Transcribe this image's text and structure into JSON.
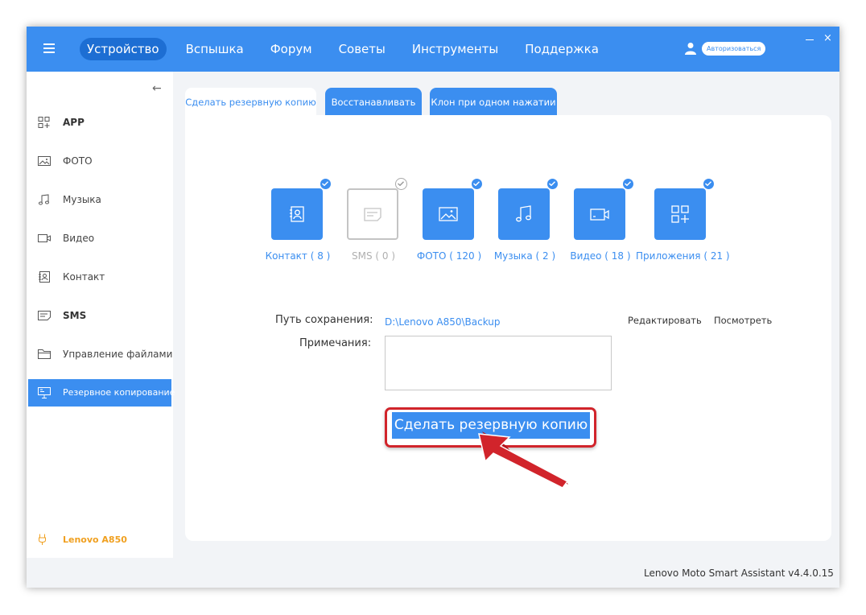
{
  "header": {
    "nav": [
      "Устройство",
      "Вспышка",
      "Форум",
      "Советы",
      "Инструменты",
      "Поддержка"
    ],
    "active_nav_index": 0,
    "login_label": "Авторизоваться",
    "close_label": "×"
  },
  "sidebar": {
    "collapse_glyph": "←",
    "items": [
      {
        "label": "APP",
        "icon": "apps-icon"
      },
      {
        "label": "ФОТО",
        "icon": "photo-icon"
      },
      {
        "label": "Музыка",
        "icon": "music-icon"
      },
      {
        "label": "Видео",
        "icon": "video-icon"
      },
      {
        "label": "Контакт",
        "icon": "contact-icon"
      },
      {
        "label": "SMS",
        "icon": "sms-icon"
      },
      {
        "label": "Управление файлами",
        "icon": "folder-icon"
      },
      {
        "label": "Резервное копирование",
        "icon": "backup-icon"
      }
    ],
    "active_index": 7,
    "device_label": "Lenovo A850"
  },
  "tabs": [
    "Сделать резервную копию",
    "Восстанавливать",
    "Клон при одном нажатии"
  ],
  "active_tab_index": 0,
  "categories": [
    {
      "label": "Контакт ( 8 )",
      "icon": "contact-icon",
      "checked": true
    },
    {
      "label": "SMS ( 0 )",
      "icon": "sms-icon",
      "checked": false
    },
    {
      "label": "ФОТО ( 120 )",
      "icon": "photo-icon",
      "checked": true
    },
    {
      "label": "Музыка ( 2 )",
      "icon": "music-icon",
      "checked": true
    },
    {
      "label": "Видео ( 18 )",
      "icon": "video-icon",
      "checked": true
    },
    {
      "label": "Приложения ( 21 )",
      "icon": "apps-icon",
      "checked": true
    }
  ],
  "backup": {
    "path_label": "Путь сохранения:",
    "path_value": "D:\\Lenovo A850\\Backup",
    "edit_label": "Редактировать",
    "view_label": "Посмотреть",
    "notes_label": "Примечания:",
    "notes_value": "",
    "button_label": "Сделать резервную копию"
  },
  "footer": {
    "version": "Lenovo Moto Smart Assistant v4.4.0.15"
  },
  "colors": {
    "accent": "#3b8ef0",
    "active_nav": "#1d6ed3",
    "device": "#f0a020",
    "highlight": "#d1242b"
  }
}
